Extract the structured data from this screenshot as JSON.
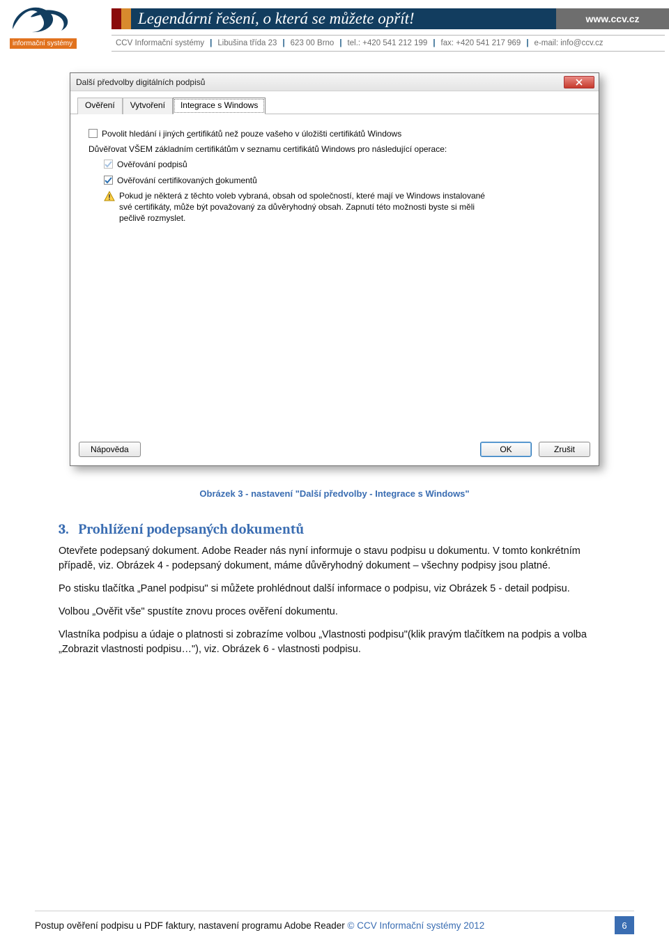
{
  "header": {
    "logo_caption": "informační systémy",
    "slogan": "Legendární řešení, o která se můžete opřít!",
    "url": "www.ccv.cz",
    "info_company": "CCV Informační systémy",
    "info_addr": "Libušina třída 23",
    "info_zipcity": "623 00  Brno",
    "info_tel": "tel.: +420 541 212 199",
    "info_fax": "fax: +420 541 217 969",
    "info_email": "e-mail: info@ccv.cz"
  },
  "dialog": {
    "title": "Další předvolby digitálních podpisů",
    "tabs": [
      "Ověření",
      "Vytvoření",
      "Integrace s Windows"
    ],
    "check1_pre": "Povolit hledání i jiných ",
    "check1_u": "c",
    "check1_post": "ertifikátů než pouze vašeho v úložišti certifikátů Windows",
    "trust_line": "Důvěřovat VŠEM základním certifikátům v seznamu certifikátů Windows pro následující operace:",
    "check2": "Ověřování podpisů",
    "check3_pre": "Ověřování certifikovaných ",
    "check3_u": "d",
    "check3_post": "okumentů",
    "warning": "Pokud je některá z těchto voleb vybraná, obsah od společností, které mají ve Windows instalované své certifikáty, může být považovaný za důvěryhodný obsah. Zapnutí této možnosti byste si měli pečlivě rozmyslet.",
    "btn_help": "Nápověda",
    "btn_ok": "OK",
    "btn_cancel": "Zrušit"
  },
  "body": {
    "caption": "Obrázek 3 - nastavení \"Další předvolby - Integrace s Windows\"",
    "h2_num": "3.",
    "h2_text": "Prohlížení podepsaných dokumentů",
    "p1": "Otevřete podepsaný dokument. Adobe Reader nás nyní informuje o stavu podpisu u dokumentu. V tomto konkrétním případě, viz. Obrázek 4 - podepsaný dokument, máme důvěryhodný dokument – všechny podpisy jsou platné.",
    "p2": "Po stisku tlačítka „Panel podpisu\" si můžete prohlédnout další informace o podpisu, viz Obrázek 5 - detail podpisu.",
    "p3": "Volbou „Ověřit vše\" spustíte znovu proces ověření dokumentu.",
    "p4": "Vlastníka podpisu a údaje o platnosti si zobrazíme volbou „Vlastnosti podpisu\"(klik pravým tlačítkem na podpis a volba „Zobrazit vlastnosti podpisu…\"), viz. Obrázek 6 - vlastnosti podpisu."
  },
  "footer": {
    "text_a": "Postup ověření podpisu u PDF faktury, nastavení programu Adobe Reader ",
    "text_b": "© CCV Informační systémy 2012",
    "page": "6"
  }
}
